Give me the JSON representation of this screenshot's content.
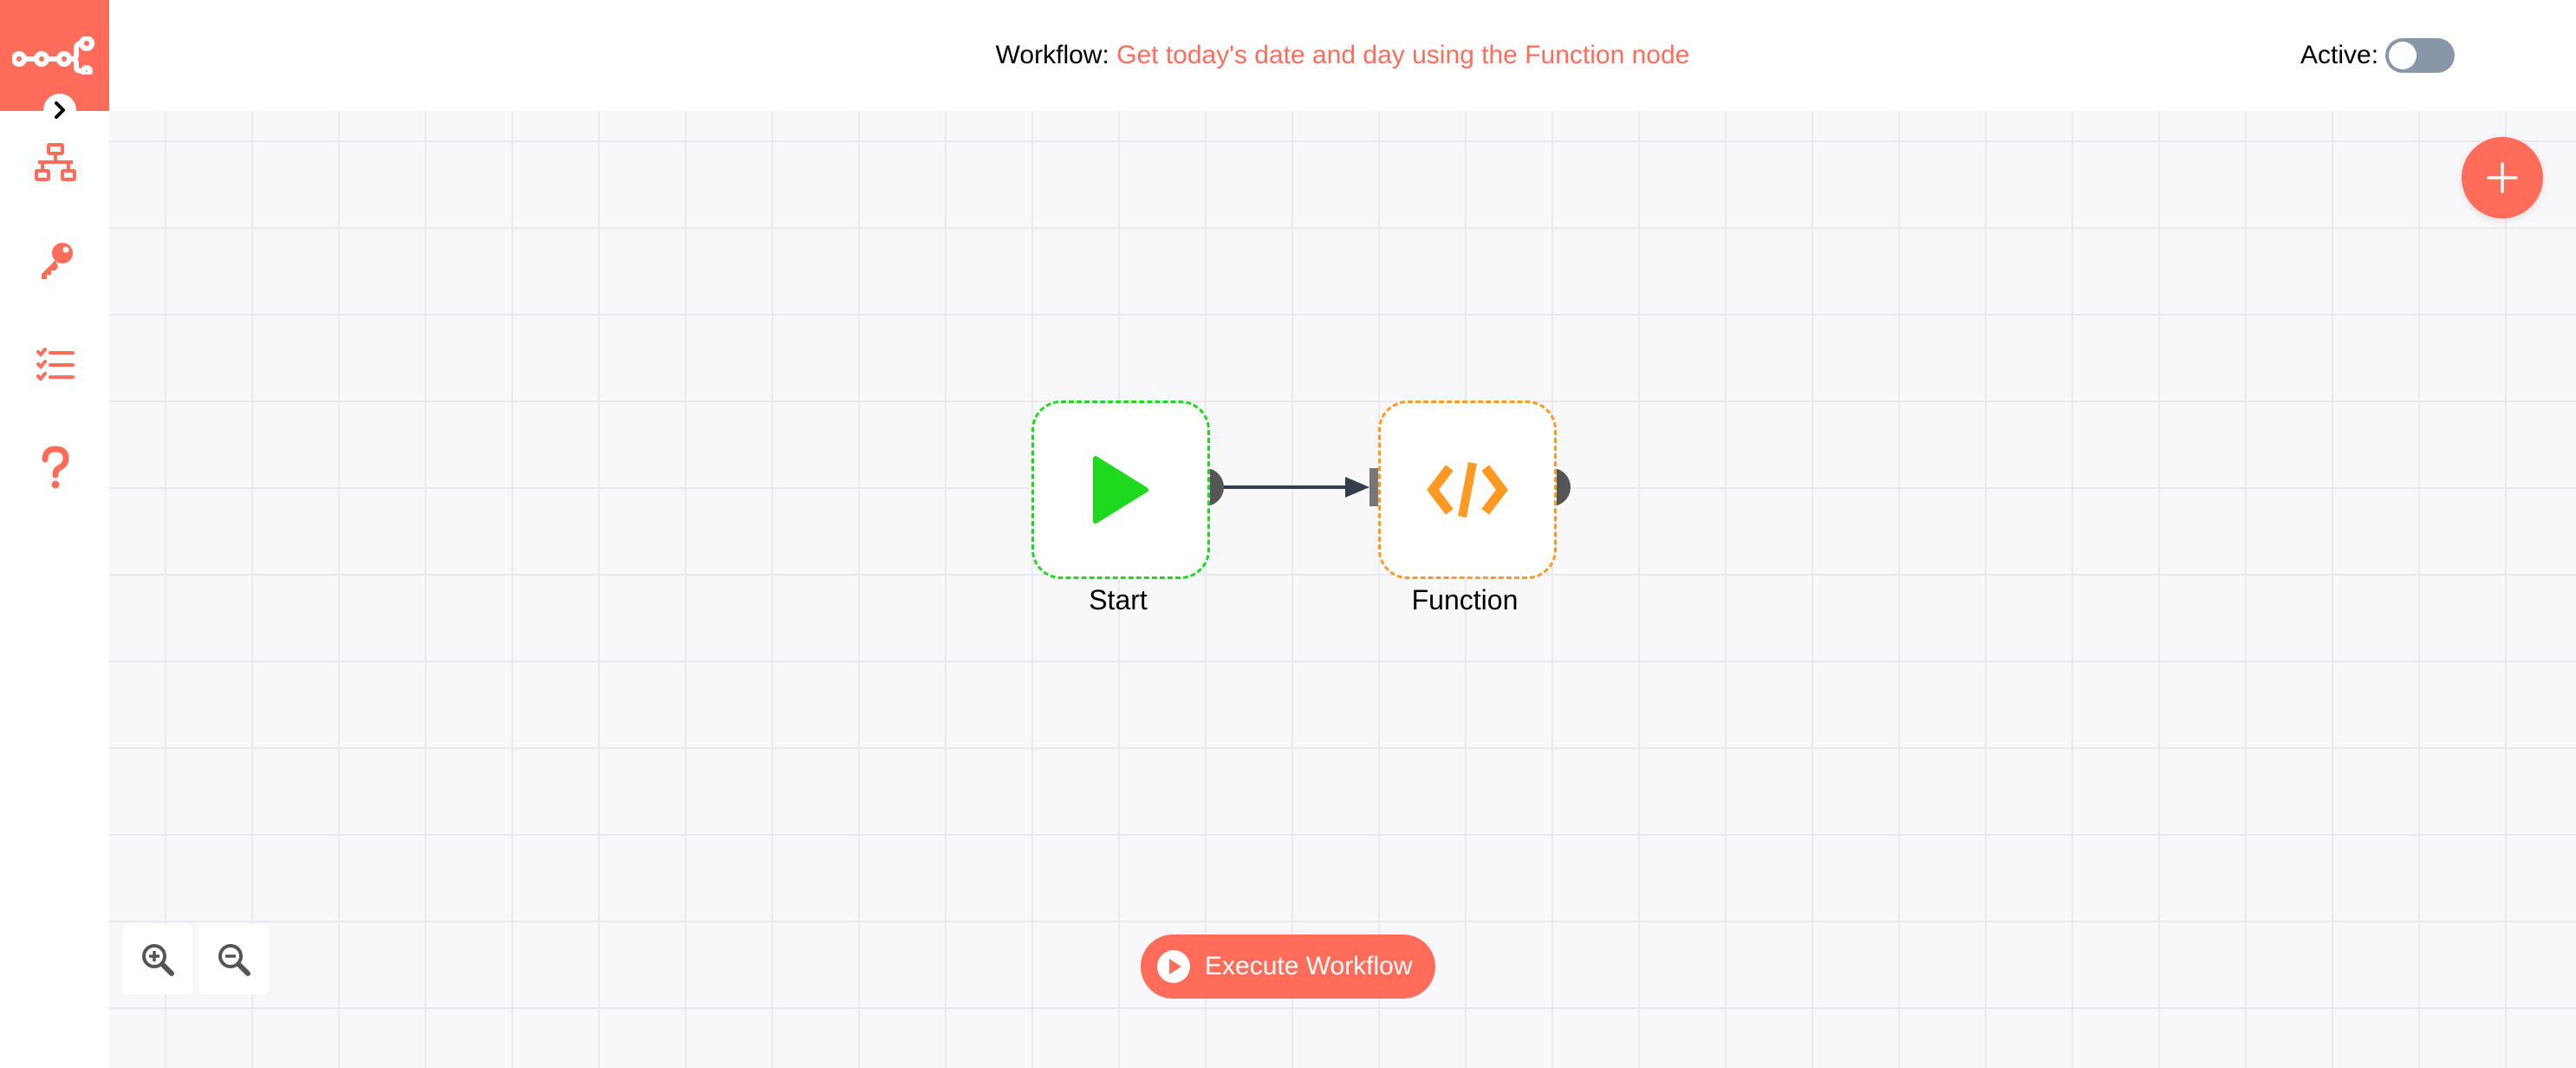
{
  "header": {
    "workflow_prefix": "Workflow:",
    "workflow_name": "Get today's date and day using the Function node",
    "active_label": "Active:",
    "active_state": false
  },
  "sidebar": {
    "items": [
      {
        "icon": "workflows-icon"
      },
      {
        "icon": "key-icon"
      },
      {
        "icon": "executions-list-icon"
      },
      {
        "icon": "help-icon"
      }
    ]
  },
  "nodes": [
    {
      "label": "Start",
      "icon": "play-icon",
      "color": "#1fd91f"
    },
    {
      "label": "Function",
      "icon": "code-icon",
      "color": "#ff9922"
    }
  ],
  "controls": {
    "execute_label": "Execute Workflow"
  },
  "colors": {
    "brand": "#ff6d5a",
    "start": "#1fd91f",
    "function": "#ff9922",
    "connection": "#333d4b"
  }
}
